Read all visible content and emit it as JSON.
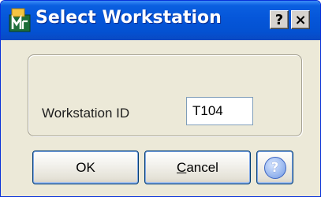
{
  "window": {
    "title": "Select Workstation",
    "help_button_glyph": "?",
    "close_button_glyph": "×",
    "app_icon": "mas-app-icon"
  },
  "form": {
    "workstation_label": "Workstation ID",
    "workstation_value": "T104"
  },
  "buttons": {
    "ok_label": "OK",
    "cancel_mnemonic": "C",
    "cancel_rest": "ancel",
    "help_glyph": "?"
  },
  "colors": {
    "titlebar": "#0556d9",
    "dialog_bg": "#ece9d8",
    "button_border": "#003c74"
  }
}
